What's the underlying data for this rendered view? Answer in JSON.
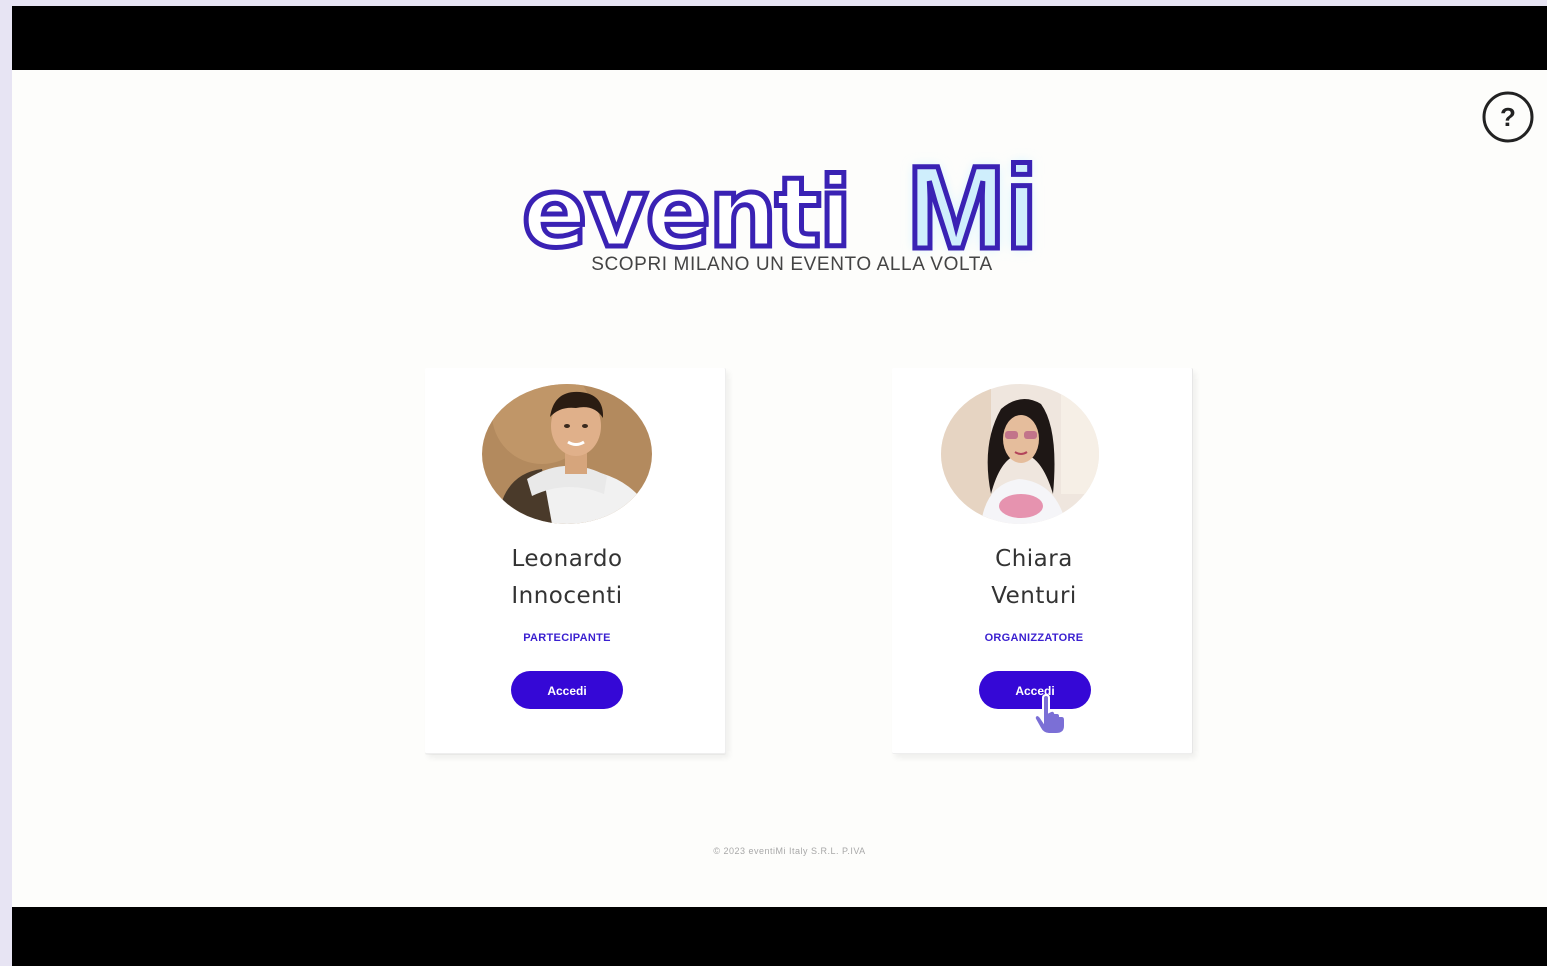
{
  "logo": {
    "word_lower": "eventi",
    "word_upper": "Mi",
    "tagline": "SCOPRI MILANO UN EVENTO ALLA VOLTA"
  },
  "help": {
    "icon": "help-icon",
    "label": "?"
  },
  "profiles": [
    {
      "first_name": "Leonardo",
      "last_name": "Innocenti",
      "role": "PARTECIPANTE",
      "button_label": "Accedi"
    },
    {
      "first_name": "Chiara",
      "last_name": "Venturi",
      "role": "ORGANIZZATORE",
      "button_label": "Accedi"
    }
  ],
  "footer": {
    "text": "© 2023 eventiMi Italy S.R.L. P.IVA"
  },
  "colors": {
    "accent": "#3508d6",
    "logo_fill": "#5a3dd8",
    "logo_outline": "#3a22b4",
    "logo_glow": "#c9f1ff"
  }
}
